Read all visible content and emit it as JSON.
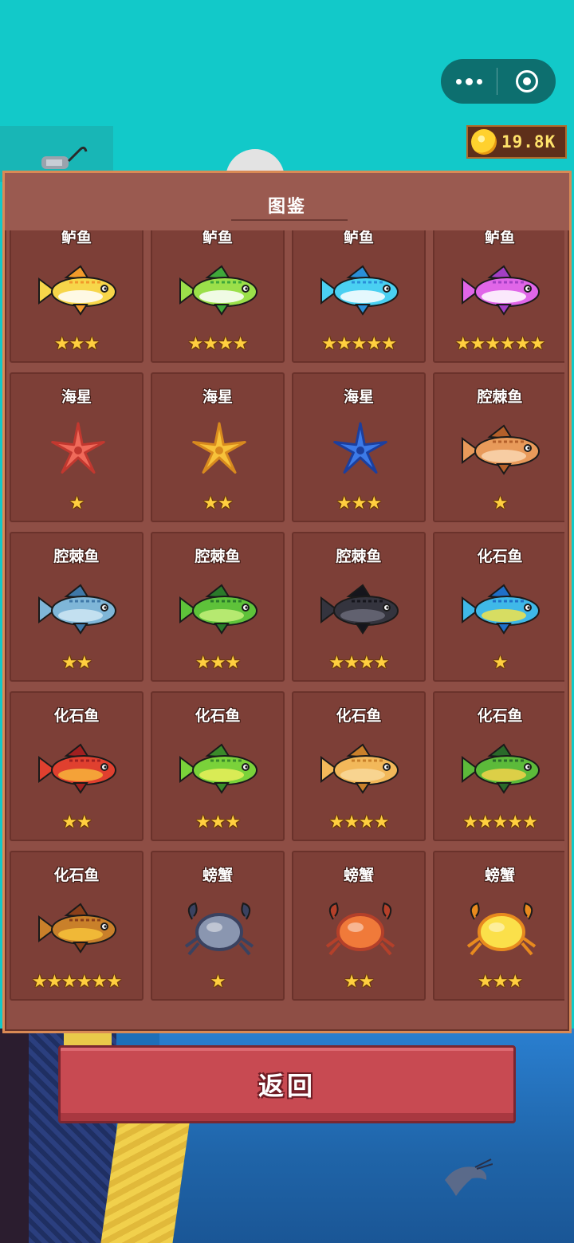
{
  "capsule": {
    "more_icon": "more-dots-icon",
    "close_icon": "target-circle-icon"
  },
  "coins": {
    "value": "19.8K",
    "icon": "gold-coin-icon"
  },
  "codex": {
    "title": "图鉴",
    "entries": [
      {
        "name": "鲈鱼",
        "stars": "★★★",
        "kind": "fish",
        "colors": [
          "#ffffff",
          "#f7d64a",
          "#f29a2a"
        ]
      },
      {
        "name": "鲈鱼",
        "stars": "★★★★",
        "kind": "fish",
        "colors": [
          "#ffffff",
          "#9be04a",
          "#3fa83a"
        ]
      },
      {
        "name": "鲈鱼",
        "stars": "★★★★★",
        "kind": "fish",
        "colors": [
          "#ffffff",
          "#4ad0f2",
          "#2a8fd8"
        ]
      },
      {
        "name": "鲈鱼",
        "stars": "★★★★★★",
        "kind": "fish",
        "colors": [
          "#ffffff",
          "#e066e8",
          "#a33fc4"
        ]
      },
      {
        "name": "海星",
        "stars": "★",
        "kind": "starfish",
        "colors": [
          "#f06a5a",
          "#c2382f"
        ]
      },
      {
        "name": "海星",
        "stars": "★★",
        "kind": "starfish",
        "colors": [
          "#f7c23a",
          "#d88a1e"
        ]
      },
      {
        "name": "海星",
        "stars": "★★★",
        "kind": "starfish",
        "colors": [
          "#3c7ae8",
          "#1c3f9e"
        ]
      },
      {
        "name": "腔棘鱼",
        "stars": "★",
        "kind": "fish",
        "colors": [
          "#f9d6b0",
          "#e89a5a",
          "#b4602a"
        ]
      },
      {
        "name": "腔棘鱼",
        "stars": "★★",
        "kind": "fish",
        "colors": [
          "#cfe8f4",
          "#7fb6d8",
          "#3f78a8"
        ]
      },
      {
        "name": "腔棘鱼",
        "stars": "★★★",
        "kind": "fish",
        "colors": [
          "#c6f07a",
          "#5ec23a",
          "#2a7a2a"
        ]
      },
      {
        "name": "腔棘鱼",
        "stars": "★★★★",
        "kind": "fish",
        "colors": [
          "#6a6a78",
          "#34343e",
          "#15151c"
        ]
      },
      {
        "name": "化石鱼",
        "stars": "★",
        "kind": "fish",
        "colors": [
          "#f2e34a",
          "#3fb8e8",
          "#1f6fc8"
        ]
      },
      {
        "name": "化石鱼",
        "stars": "★★",
        "kind": "fish",
        "colors": [
          "#f7b43a",
          "#e0402f",
          "#a02020"
        ]
      },
      {
        "name": "化石鱼",
        "stars": "★★★",
        "kind": "fish",
        "colors": [
          "#eaf05a",
          "#7ad23a",
          "#3a8a2a"
        ]
      },
      {
        "name": "化石鱼",
        "stars": "★★★★",
        "kind": "fish",
        "colors": [
          "#f9d89a",
          "#f2b85a",
          "#c9802a"
        ]
      },
      {
        "name": "化石鱼",
        "stars": "★★★★★",
        "kind": "fish",
        "colors": [
          "#f2d24a",
          "#5cba3a",
          "#2a6a2a"
        ]
      },
      {
        "name": "化石鱼",
        "stars": "★★★★★★",
        "kind": "fish",
        "colors": [
          "#f7c23a",
          "#c9802a",
          "#8a3f1a"
        ]
      },
      {
        "name": "螃蟹",
        "stars": "★",
        "kind": "crab",
        "colors": [
          "#8a96b0",
          "#3a4260"
        ]
      },
      {
        "name": "螃蟹",
        "stars": "★★",
        "kind": "crab",
        "colors": [
          "#f07a3a",
          "#b4402a"
        ]
      },
      {
        "name": "螃蟹",
        "stars": "★★★",
        "kind": "crab",
        "colors": [
          "#fbe04a",
          "#e88a1e"
        ]
      }
    ]
  },
  "actions": {
    "back_label": "返回"
  }
}
